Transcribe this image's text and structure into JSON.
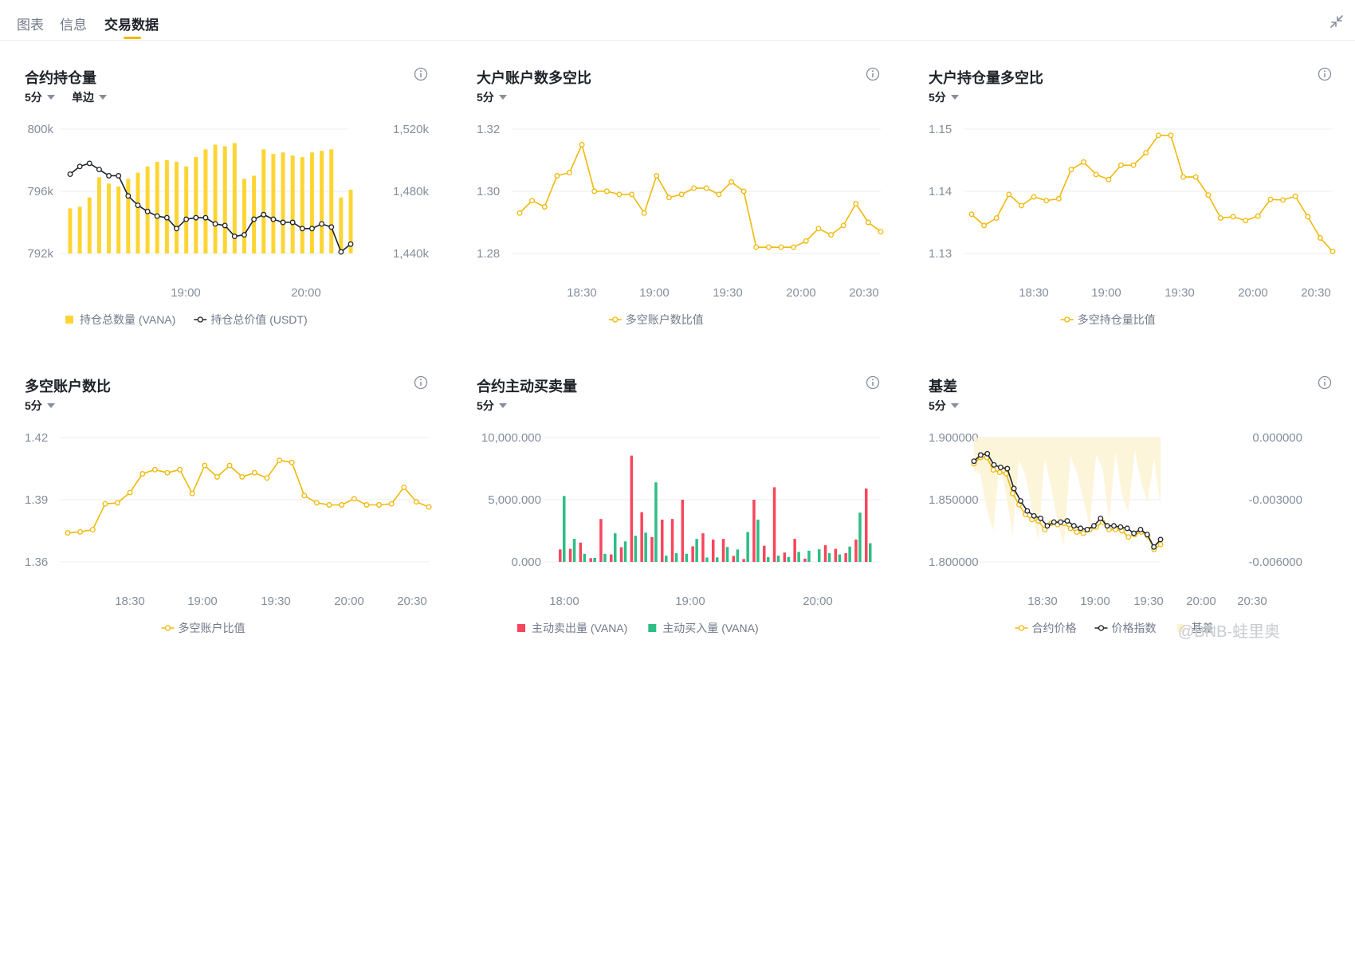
{
  "tabs": [
    {
      "label": "图表",
      "active": false
    },
    {
      "label": "信息",
      "active": false
    },
    {
      "label": "交易数据",
      "active": true
    }
  ],
  "colors": {
    "accent": "#f0b90b",
    "bar_yellow": "#fcd535",
    "line_black": "#1e2329",
    "sell_red": "#f6465d",
    "buy_green": "#2ebd85",
    "basis_fill": "#fdf3d2"
  },
  "watermark": "@BNB-蛙里奥",
  "panels": [
    {
      "title": "合约持仓量",
      "dropdowns": [
        "5分",
        "单边"
      ],
      "chart_data": {
        "type": "bar",
        "x_ticks": [
          "19:00",
          "20:00"
        ],
        "y_left": {
          "ticks": [
            "800k",
            "796k",
            "792k"
          ],
          "range": [
            792,
            800
          ]
        },
        "y_right": {
          "ticks": [
            "1,520k",
            "1,480k",
            "1,440k"
          ],
          "range": [
            1440,
            1520
          ]
        },
        "legend": [
          "持仓总数量 (VANA)",
          "持仓总价值 (USDT)"
        ],
        "series": [
          {
            "name": "持仓总数量 (VANA)",
            "type": "bar",
            "axis": "left",
            "values": [
              794.9,
              795.0,
              795.6,
              796.9,
              796.5,
              796.3,
              796.8,
              797.2,
              797.6,
              797.9,
              798.0,
              797.9,
              797.6,
              798.2,
              798.7,
              799.0,
              798.9,
              799.1,
              796.8,
              797.0,
              798.7,
              798.4,
              798.5,
              798.3,
              798.2,
              798.5,
              798.6,
              798.7,
              795.6,
              796.1
            ]
          },
          {
            "name": "持仓总价值 (USDT)",
            "type": "line",
            "axis": "right",
            "values": [
              1491,
              1496,
              1498,
              1494,
              1490,
              1490,
              1477,
              1471,
              1467,
              1464,
              1463,
              1456,
              1462,
              1463,
              1463,
              1459,
              1458,
              1451,
              1452,
              1462,
              1465,
              1462,
              1460,
              1460,
              1456,
              1456,
              1459,
              1457,
              1441,
              1446
            ]
          }
        ]
      }
    },
    {
      "title": "大户账户数多空比",
      "dropdowns": [
        "5分"
      ],
      "chart_data": {
        "type": "line",
        "x_ticks": [
          "18:30",
          "19:00",
          "19:30",
          "20:00",
          "20:30"
        ],
        "y_ticks": [
          "1.32",
          "1.30",
          "1.28"
        ],
        "ylim": [
          1.28,
          1.32
        ],
        "legend": [
          "多空账户数比值"
        ],
        "series": [
          {
            "name": "多空账户数比值",
            "values": [
              1.293,
              1.297,
              1.295,
              1.305,
              1.306,
              1.315,
              1.3,
              1.3,
              1.299,
              1.299,
              1.293,
              1.305,
              1.298,
              1.299,
              1.301,
              1.301,
              1.299,
              1.303,
              1.3,
              1.282,
              1.282,
              1.282,
              1.282,
              1.284,
              1.288,
              1.286,
              1.289,
              1.296,
              1.29,
              1.287
            ]
          }
        ]
      }
    },
    {
      "title": "大户持仓量多空比",
      "dropdowns": [
        "5分"
      ],
      "chart_data": {
        "type": "line",
        "x_ticks": [
          "18:30",
          "19:00",
          "19:30",
          "20:00",
          "20:30"
        ],
        "y_ticks": [
          "1.15",
          "1.14",
          "1.13"
        ],
        "ylim": [
          1.13,
          1.15
        ],
        "legend": [
          "多空持仓量比值"
        ],
        "series": [
          {
            "name": "多空持仓量比值",
            "values": [
              1.1363,
              1.1345,
              1.1357,
              1.1395,
              1.1377,
              1.1391,
              1.1385,
              1.1388,
              1.1435,
              1.1447,
              1.1427,
              1.1419,
              1.1442,
              1.1442,
              1.1462,
              1.149,
              1.149,
              1.1423,
              1.1423,
              1.1394,
              1.1357,
              1.1359,
              1.1353,
              1.136,
              1.1387,
              1.1386,
              1.1392,
              1.1359,
              1.1325,
              1.1303
            ]
          }
        ]
      }
    },
    {
      "title": "多空账户数比",
      "dropdowns": [
        "5分"
      ],
      "chart_data": {
        "type": "line",
        "x_ticks": [
          "18:30",
          "19:00",
          "19:30",
          "20:00",
          "20:30"
        ],
        "y_ticks": [
          "1.42",
          "1.39",
          "1.36"
        ],
        "ylim": [
          1.36,
          1.42
        ],
        "legend": [
          "多空账户比值"
        ],
        "series": [
          {
            "name": "多空账户比值",
            "values": [
              1.374,
              1.3745,
              1.3755,
              1.388,
              1.3885,
              1.3935,
              1.4025,
              1.4045,
              1.403,
              1.4045,
              1.393,
              1.4065,
              1.401,
              1.4065,
              1.401,
              1.403,
              1.4005,
              1.409,
              1.408,
              1.392,
              1.3885,
              1.3875,
              1.3875,
              1.3905,
              1.3875,
              1.3875,
              1.388,
              1.396,
              1.389,
              1.3865
            ]
          }
        ]
      }
    },
    {
      "title": "合约主动买卖量",
      "dropdowns": [
        "5分"
      ],
      "chart_data": {
        "type": "bar",
        "x_ticks": [
          "18:00",
          "19:00",
          "20:00"
        ],
        "y_ticks": [
          "10,000.000",
          "5,000.000",
          "0.000"
        ],
        "ylim": [
          0,
          10000
        ],
        "legend": [
          "主动卖出量 (VANA)",
          "主动买入量 (VANA)"
        ],
        "series": [
          {
            "name": "主动卖出量 (VANA)",
            "values": [
              1000,
              1050,
              1550,
              300,
              3450,
              600,
              1180,
              8550,
              4000,
              2000,
              3400,
              3450,
              5000,
              1250,
              2300,
              1800,
              1850,
              480,
              230,
              5000,
              1300,
              6000,
              750,
              1850,
              260,
              0,
              1340,
              1050,
              700,
              1800,
              5900
            ]
          },
          {
            "name": "主动买入量 (VANA)",
            "values": [
              5300,
              1850,
              650,
              320,
              650,
              2300,
              1650,
              2100,
              2350,
              6400,
              500,
              700,
              650,
              1850,
              350,
              360,
              1200,
              1000,
              2400,
              3400,
              380,
              500,
              400,
              800,
              900,
              1010,
              700,
              600,
              1230,
              3960,
              1500
            ]
          }
        ]
      }
    },
    {
      "title": "基差",
      "dropdowns": [
        "5分"
      ],
      "chart_data": {
        "type": "line",
        "x_ticks": [
          "18:30",
          "19:00",
          "19:30",
          "20:00",
          "20:30"
        ],
        "y_left": {
          "ticks": [
            "1.900000",
            "1.850000",
            "1.800000"
          ],
          "range": [
            1.8,
            1.9
          ]
        },
        "y_right": {
          "ticks": [
            "0.000000",
            "-0.003000",
            "-0.006000"
          ],
          "range": [
            -0.006,
            0
          ]
        },
        "legend": [
          "合约价格",
          "价格指数",
          "基差"
        ],
        "series": [
          {
            "name": "合约价格",
            "values": [
              1.879,
              1.884,
              1.884,
              1.874,
              1.872,
              1.871,
              1.855,
              1.846,
              1.838,
              1.834,
              1.833,
              1.826,
              1.831,
              1.83,
              1.831,
              1.827,
              1.824,
              1.823,
              1.826,
              1.828,
              1.832,
              1.826,
              1.826,
              1.825,
              1.82,
              1.822,
              1.824,
              1.821,
              1.81,
              1.814
            ]
          },
          {
            "name": "价格指数",
            "values": [
              1.881,
              1.886,
              1.887,
              1.878,
              1.876,
              1.875,
              1.859,
              1.849,
              1.841,
              1.837,
              1.835,
              1.829,
              1.832,
              1.832,
              1.833,
              1.829,
              1.827,
              1.826,
              1.829,
              1.835,
              1.829,
              1.829,
              1.828,
              1.827,
              1.823,
              1.826,
              1.822,
              1.812,
              1.818
            ]
          },
          {
            "name": "基差",
            "type": "area",
            "values": [
              -0.0016,
              -0.0018,
              -0.0035,
              -0.0045,
              -0.0011,
              -0.0028,
              -0.0047,
              -0.0011,
              -0.0018,
              -0.0034,
              -0.005,
              -0.001,
              -0.0024,
              -0.0041,
              -0.0052,
              -0.0009,
              -0.0017,
              -0.003,
              -0.0043,
              -0.0008,
              -0.0015,
              -0.004,
              -0.0007,
              -0.0028,
              -0.0036,
              -0.0006,
              -0.0022,
              -0.0031,
              -0.001,
              -0.0033
            ]
          }
        ]
      }
    }
  ]
}
